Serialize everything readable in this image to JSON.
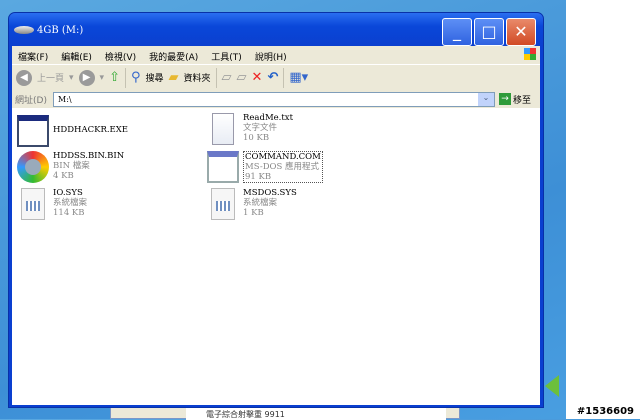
{
  "window": {
    "title": "4GB (M:)"
  },
  "menu": [
    "檔案(F)",
    "編輯(E)",
    "檢視(V)",
    "我的最愛(A)",
    "工具(T)",
    "說明(H)"
  ],
  "toolbar": {
    "back": "上一頁",
    "search": "搜尋",
    "folders": "資料夾"
  },
  "address": {
    "label": "網址(D)",
    "value": "M:\\",
    "go": "移至"
  },
  "files": [
    {
      "name": "HDDHACKR.EXE",
      "type": "",
      "size": "",
      "icon": "exe-window-icon"
    },
    {
      "name": "ReadMe.txt",
      "type": "文字文件",
      "size": "10 KB",
      "icon": "text-document-icon"
    },
    {
      "name": "HDDSS.BIN.BIN",
      "type": "BIN 檔案",
      "size": "4 KB",
      "icon": "disk-app-icon"
    },
    {
      "name": "COMMAND.COM",
      "type": "MS-DOS 應用程式",
      "size": "91 KB",
      "icon": "msdos-app-icon"
    },
    {
      "name": "IO.SYS",
      "type": "系統檔案",
      "size": "114 KB",
      "icon": "system-file-icon"
    },
    {
      "name": "MSDOS.SYS",
      "type": "系統檔案",
      "size": "1 KB",
      "icon": "system-file-icon"
    }
  ],
  "background_window": {
    "text": "電子綜合射擊重 9911"
  },
  "watermark": "#1536609"
}
